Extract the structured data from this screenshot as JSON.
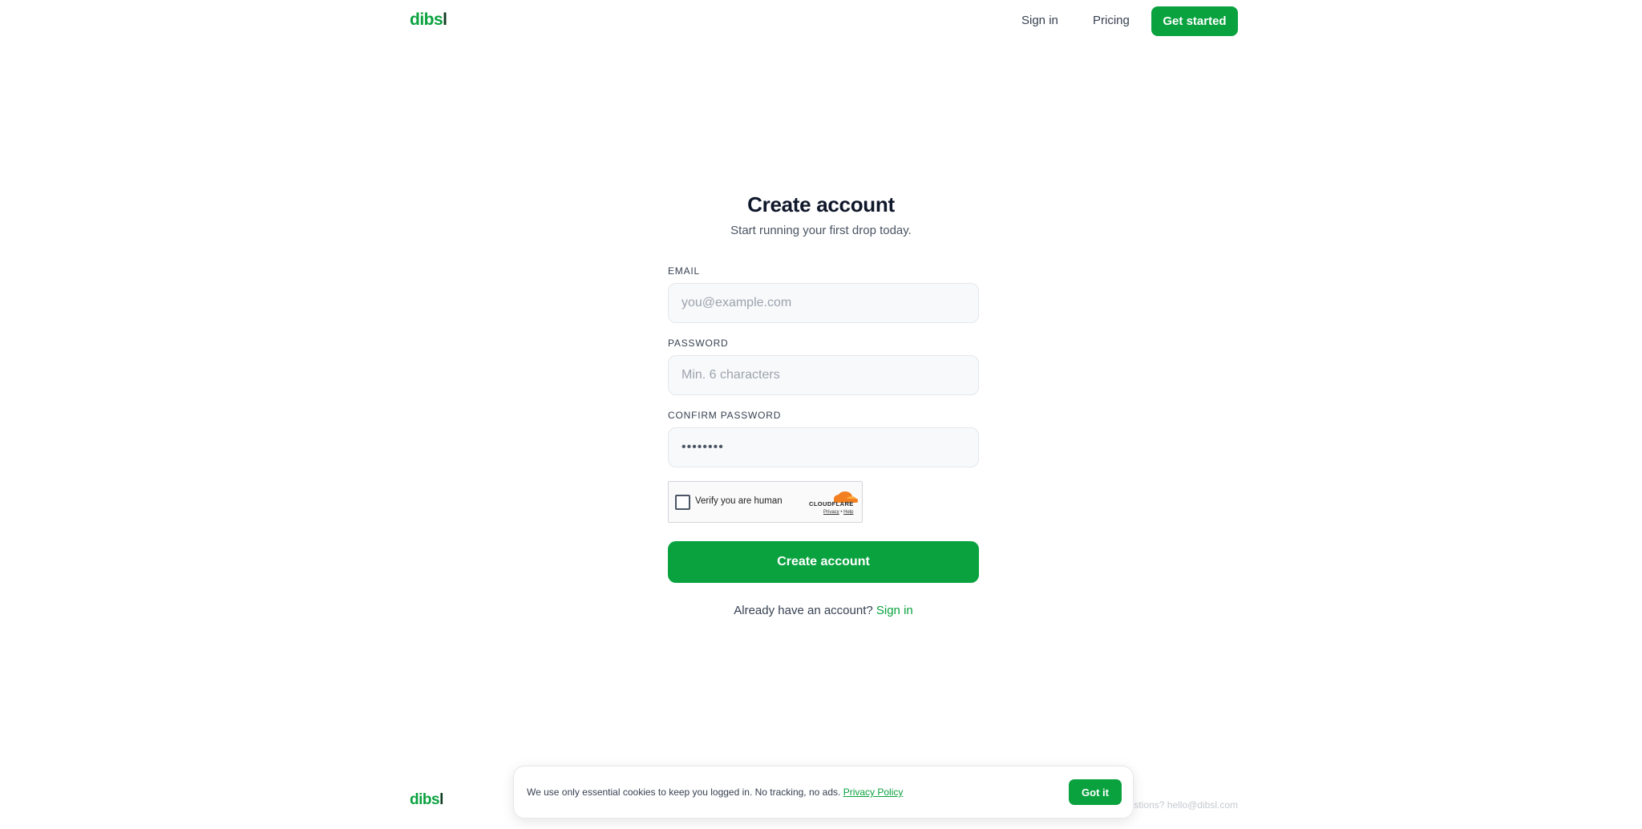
{
  "header": {
    "logo_main": "dibs",
    "logo_tail": "l",
    "nav": {
      "sign_in": "Sign in",
      "pricing": "Pricing",
      "get_started": "Get started"
    }
  },
  "form": {
    "title": "Create account",
    "subtitle": "Start running your first drop today.",
    "email": {
      "label": "EMAIL",
      "placeholder": "you@example.com",
      "value": ""
    },
    "password": {
      "label": "PASSWORD",
      "placeholder": "Min. 6 characters",
      "value": ""
    },
    "confirm_password": {
      "label": "CONFIRM PASSWORD",
      "value": "••••••••"
    },
    "captcha": {
      "text": "Verify you are human",
      "brand": "CLOUDFLARE",
      "privacy": "Privacy",
      "separator": " • ",
      "help": "Help"
    },
    "submit_label": "Create account",
    "signin_prompt": "Already have an account?",
    "signin_link": "Sign in"
  },
  "footer": {
    "logo_main": "dibs",
    "logo_tail": "l",
    "contact": "Questions? hello@dibsl.com"
  },
  "cookie_banner": {
    "text": "We use only essential cookies to keep you logged in. No tracking, no ads.",
    "link": "Privacy Policy",
    "button": "Got it"
  },
  "colors": {
    "brand_green": "#0aa23f",
    "logo_dark": "#0d3b1e",
    "cloudflare_orange": "#f38020"
  }
}
